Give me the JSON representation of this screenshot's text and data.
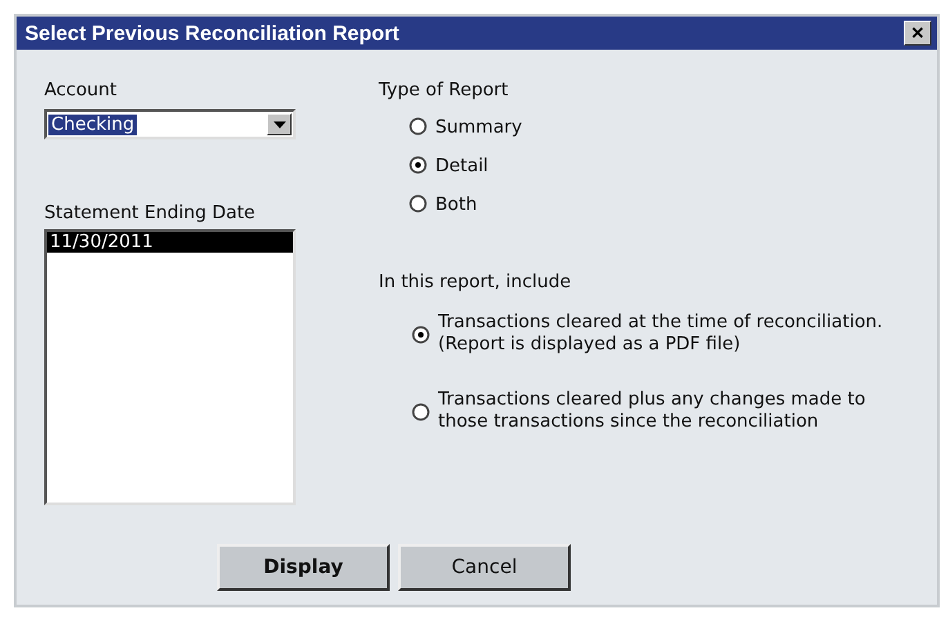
{
  "window": {
    "title": "Select Previous Reconciliation Report",
    "close": "✕"
  },
  "account": {
    "label": "Account",
    "value": "Checking"
  },
  "statement": {
    "label": "Statement Ending Date",
    "items": [
      {
        "label": "11/30/2011",
        "selected": true
      }
    ]
  },
  "report_type": {
    "label": "Type of Report",
    "options": [
      {
        "label": "Summary",
        "selected": false
      },
      {
        "label": "Detail",
        "selected": true
      },
      {
        "label": "Both",
        "selected": false
      }
    ]
  },
  "include": {
    "label": "In this report, include",
    "options": [
      {
        "label": "Transactions cleared at the time of reconciliation.\n(Report is displayed as a PDF file)",
        "selected": true
      },
      {
        "label": "Transactions cleared plus any changes made to\nthose transactions since the reconciliation",
        "selected": false
      }
    ]
  },
  "buttons": [
    {
      "label": "Display",
      "default": true
    },
    {
      "label": "Cancel",
      "default": false
    }
  ]
}
